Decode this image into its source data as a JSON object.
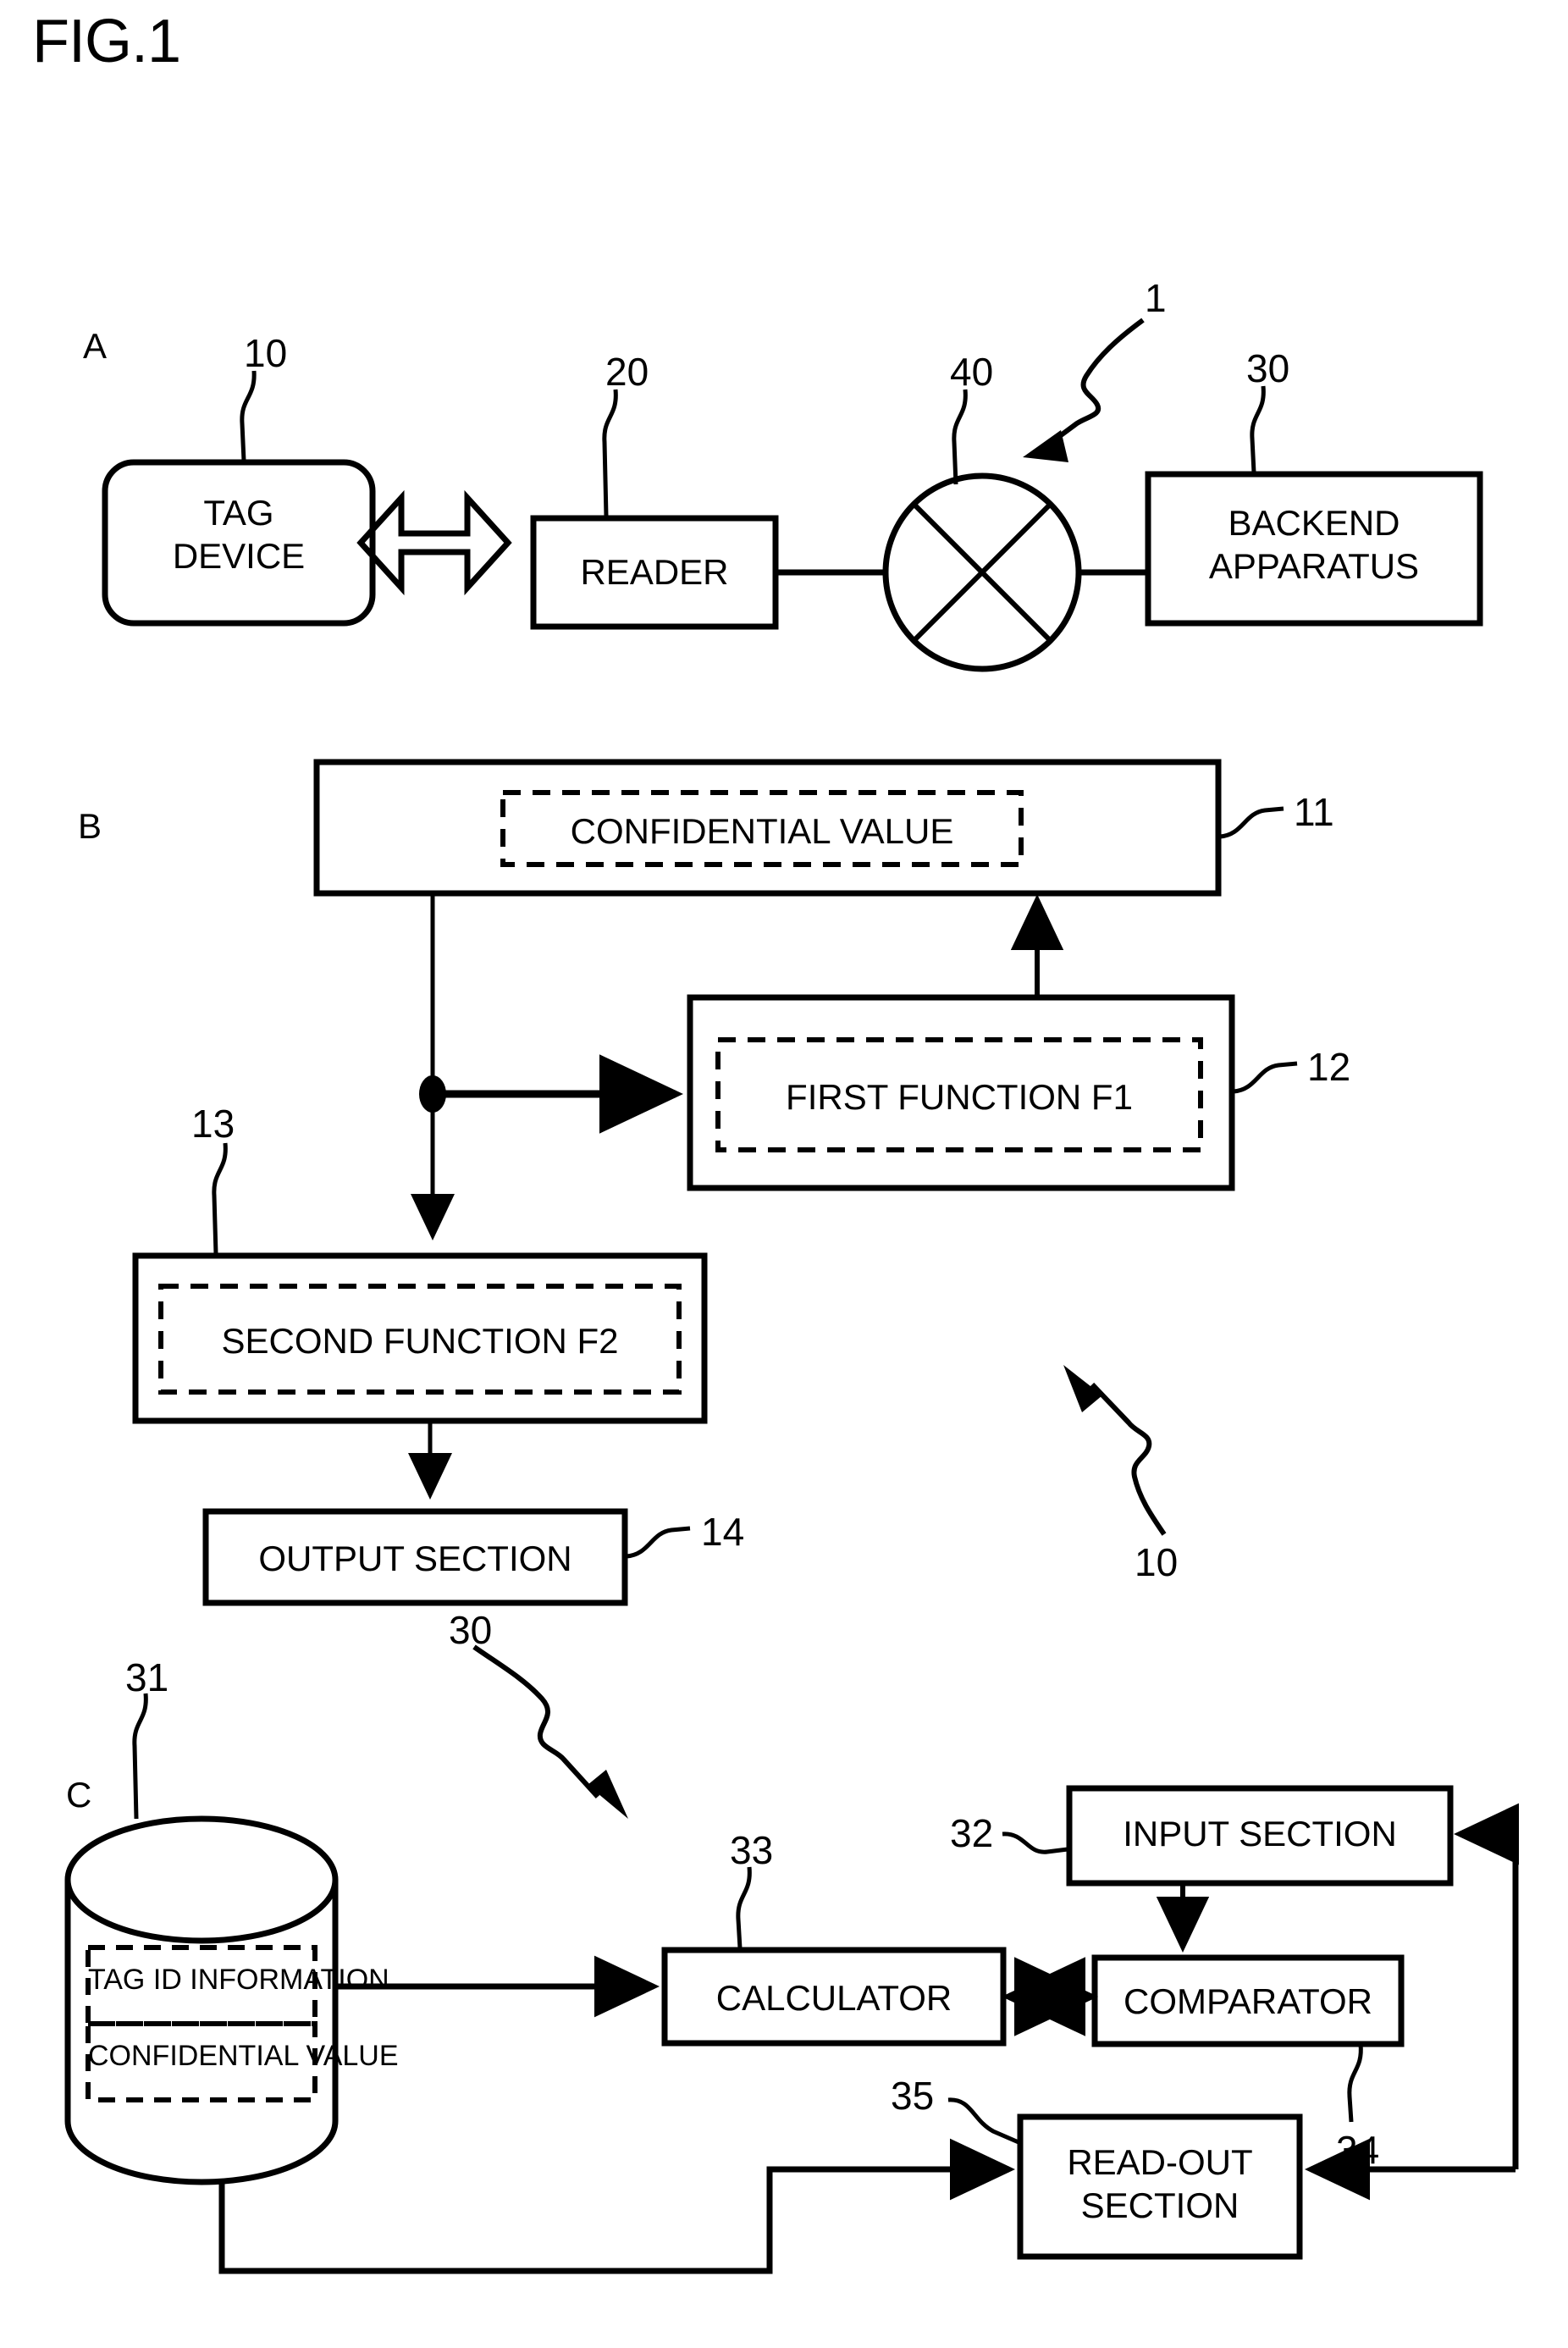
{
  "figure": {
    "title": "FIG.1",
    "panels": [
      {
        "letter": "A"
      },
      {
        "letter": "B"
      },
      {
        "letter": "C"
      }
    ]
  },
  "panel_a": {
    "letter": "A",
    "system_ref": "1",
    "nodes": [
      {
        "id": "tag-device",
        "label": "TAG\nDEVICE",
        "ref": "10",
        "shape": "rounded-rect"
      },
      {
        "id": "reader",
        "label": "READER",
        "ref": "20",
        "shape": "rect"
      },
      {
        "id": "network",
        "label": "",
        "ref": "40",
        "shape": "crossed-circle"
      },
      {
        "id": "backend-apparatus",
        "label": "BACKEND\nAPPARATUS",
        "ref": "30",
        "shape": "rect"
      }
    ],
    "connectors": [
      {
        "from": "tag-device",
        "to": "reader",
        "style": "hollow-double-arrow"
      },
      {
        "from": "reader",
        "to": "network",
        "style": "line"
      },
      {
        "from": "network",
        "to": "backend-apparatus",
        "style": "line"
      }
    ]
  },
  "panel_b": {
    "letter": "B",
    "device_ref": "10",
    "nodes": [
      {
        "id": "confidential-value",
        "label": "CONFIDENTIAL VALUE",
        "ref": "11",
        "inner": "dashed"
      },
      {
        "id": "first-function",
        "label": "FIRST FUNCTION F1",
        "ref": "12",
        "inner": "dashed"
      },
      {
        "id": "second-function",
        "label": "SECOND FUNCTION F2",
        "ref": "13",
        "inner": "dashed"
      },
      {
        "id": "output-section",
        "label": "OUTPUT SECTION",
        "ref": "14",
        "inner": "none"
      }
    ],
    "connectors": [
      {
        "from": "confidential-value",
        "to": "junction",
        "style": "line"
      },
      {
        "from": "junction",
        "to": "first-function",
        "style": "arrow"
      },
      {
        "from": "first-function",
        "to": "confidential-value",
        "style": "arrow"
      },
      {
        "from": "junction",
        "to": "second-function",
        "style": "arrow"
      },
      {
        "from": "second-function",
        "to": "output-section",
        "style": "arrow"
      }
    ]
  },
  "panel_c": {
    "letter": "C",
    "apparatus_ref": "30",
    "database": {
      "id": "database",
      "ref": "31",
      "rows": [
        "TAG ID INFORMATION",
        "CONFIDENTIAL VALUE"
      ]
    },
    "nodes": [
      {
        "id": "calculator",
        "label": "CALCULATOR",
        "ref": "33"
      },
      {
        "id": "input-section",
        "label": "INPUT SECTION",
        "ref": "32"
      },
      {
        "id": "comparator",
        "label": "COMPARATOR",
        "ref": "34"
      },
      {
        "id": "read-out-section",
        "label": "READ-OUT\nSECTION",
        "ref": "35"
      }
    ],
    "connectors": [
      {
        "from": "database",
        "to": "calculator",
        "style": "arrow"
      },
      {
        "from": "calculator",
        "to": "comparator",
        "style": "double-arrow"
      },
      {
        "from": "input-section",
        "to": "comparator",
        "style": "arrow"
      },
      {
        "from": "database",
        "to": "read-out-section",
        "style": "arrow"
      },
      {
        "from": "comparator-loop",
        "to": "read-out-section",
        "style": "arrow"
      },
      {
        "from": "comparator-loop",
        "to": "input-section",
        "style": "arrow"
      }
    ]
  },
  "colors": {
    "ink": "#000000",
    "paper": "#ffffff"
  }
}
